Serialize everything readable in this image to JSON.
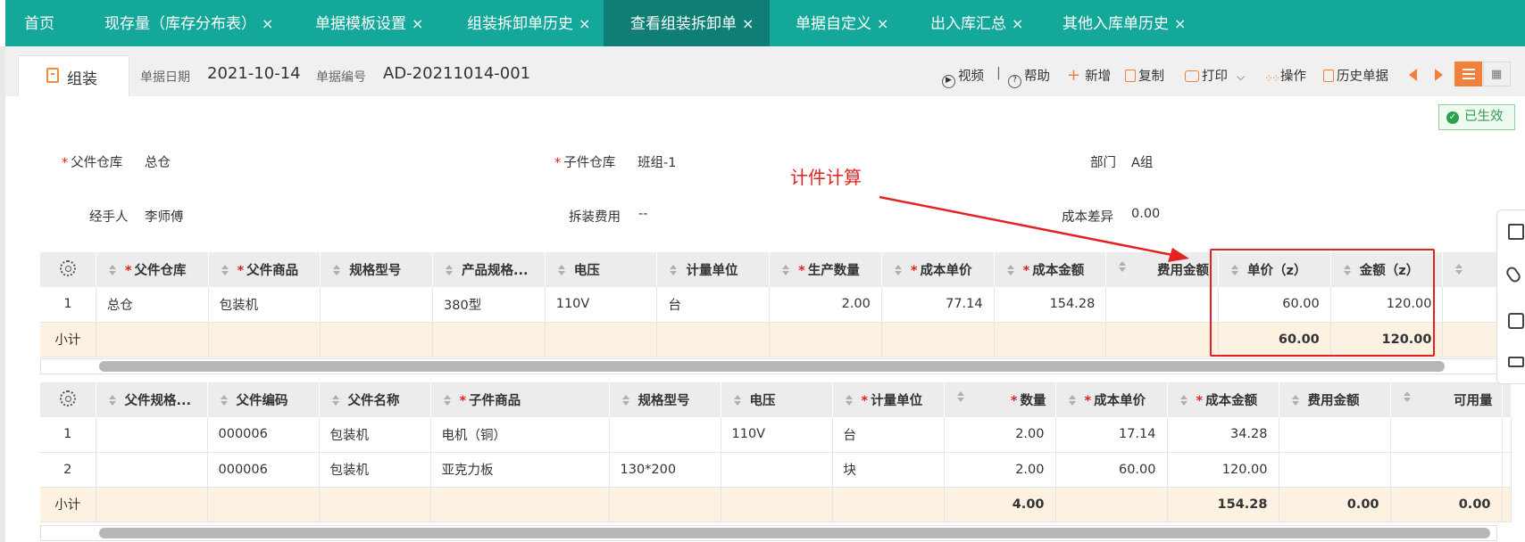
{
  "tabs": [
    {
      "label": "首页",
      "closable": false
    },
    {
      "label": "现存量（库存分布表）",
      "closable": true
    },
    {
      "label": "单据模板设置",
      "closable": true
    },
    {
      "label": "组装拆卸单历史",
      "closable": true
    },
    {
      "label": "查看组装拆卸单",
      "closable": true,
      "active": true
    },
    {
      "label": "单据自定义",
      "closable": true
    },
    {
      "label": "出入库汇总",
      "closable": true
    },
    {
      "label": "其他入库单历史",
      "closable": true
    }
  ],
  "close_glyph": "×",
  "doc": {
    "type_label": "组装",
    "date_label": "单据日期",
    "date_value": "2021-10-14",
    "no_label": "单据编号",
    "no_value": "AD-20211014-001"
  },
  "toolbar": {
    "video": "视频",
    "sep": "|",
    "help": "帮助",
    "add": "新增",
    "copy": "复制",
    "print": "打印",
    "operate": "操作",
    "history": "历史单据"
  },
  "status_badge": "已生效",
  "form": {
    "parent_wh_label": "父件仓库",
    "parent_wh_value": "总仓",
    "child_wh_label": "子件仓库",
    "child_wh_value": "班组-1",
    "dept_label": "部门",
    "dept_value": "A组",
    "handler_label": "经手人",
    "handler_value": "李师傅",
    "fee_label": "拆装费用",
    "fee_value": "--",
    "diff_label": "成本差异",
    "diff_value": "0.00"
  },
  "annotation": "计件计算",
  "colors": {
    "tab_bar": "#14a89a",
    "tab_active": "#0f7f76",
    "accent": "#f0803c",
    "annotation": "#e32222",
    "subtotal_bg": "#fdf1e2"
  },
  "table1": {
    "headers": [
      "父件仓库",
      "父件商品",
      "规格型号",
      "产品规格...",
      "电压",
      "计量单位",
      "生产数量",
      "成本单价",
      "成本金额",
      "费用金额",
      "单价（z）",
      "金额（z）"
    ],
    "required": [
      true,
      true,
      false,
      false,
      false,
      false,
      true,
      true,
      true,
      false,
      false,
      false
    ],
    "rows": [
      {
        "idx": "1",
        "cells": [
          "总仓",
          "包装机",
          "",
          "380型",
          "110V",
          "台",
          "2.00",
          "77.14",
          "154.28",
          "",
          "60.00",
          "120.00"
        ]
      }
    ],
    "subtotal": {
      "label": "小计",
      "cells": [
        "",
        "",
        "",
        "",
        "",
        "",
        "",
        "",
        "",
        "",
        "60.00",
        "120.00"
      ]
    }
  },
  "table2": {
    "headers": [
      "父件规格...",
      "父件编码",
      "父件名称",
      "子件商品",
      "规格型号",
      "电压",
      "计量单位",
      "数量",
      "成本单价",
      "成本金额",
      "费用金额",
      "可用量"
    ],
    "required": [
      false,
      false,
      false,
      true,
      false,
      false,
      true,
      true,
      true,
      true,
      false,
      false
    ],
    "rows": [
      {
        "idx": "1",
        "cells": [
          "",
          "000006",
          "包装机",
          "电机（铜）",
          "",
          "110V",
          "台",
          "2.00",
          "17.14",
          "34.28",
          "",
          ""
        ]
      },
      {
        "idx": "2",
        "cells": [
          "",
          "000006",
          "包装机",
          "亚克力板",
          "130*200",
          "",
          "块",
          "2.00",
          "60.00",
          "120.00",
          "",
          ""
        ]
      }
    ],
    "subtotal": {
      "label": "小计",
      "cells": [
        "",
        "",
        "",
        "",
        "",
        "",
        "",
        "4.00",
        "",
        "154.28",
        "0.00",
        "0.00"
      ]
    }
  }
}
